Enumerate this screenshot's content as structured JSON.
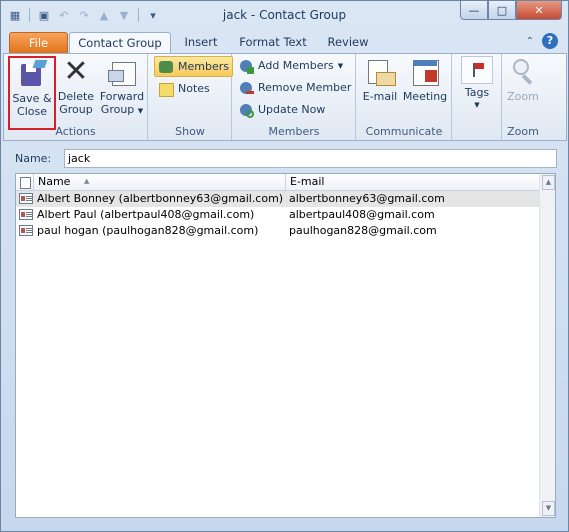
{
  "title": {
    "text": "jack  -  Contact Group"
  },
  "quick_access": [
    "outlook-icon",
    "save-icon",
    "undo-icon",
    "redo-icon",
    "up-icon",
    "down-icon",
    "customize-icon"
  ],
  "tabs": {
    "file": "File",
    "contact_group": "Contact Group",
    "insert": "Insert",
    "format_text": "Format Text",
    "review": "Review"
  },
  "ribbon": {
    "actions": {
      "save_close_1": "Save &",
      "save_close_2": "Close",
      "delete_1": "Delete",
      "delete_2": "Group",
      "forward_1": "Forward",
      "forward_2": "Group",
      "label": "Actions"
    },
    "show": {
      "members": "Members",
      "notes": "Notes",
      "label": "Show"
    },
    "members": {
      "add": "Add Members",
      "remove": "Remove Member",
      "update": "Update Now",
      "label": "Members"
    },
    "communicate": {
      "email": "E-mail",
      "meeting": "Meeting",
      "label": "Communicate"
    },
    "tags": {
      "tags": "Tags",
      "zoom_btn": "Zoom"
    },
    "zoom": {
      "zoom": "Zoom",
      "label": "Zoom"
    }
  },
  "name_field": {
    "label": "Name:",
    "value": "jack"
  },
  "list": {
    "headers": {
      "name": "Name",
      "email": "E-mail"
    },
    "rows": [
      {
        "name": "Albert Bonney (albertbonney63@gmail.com)",
        "email": "albertbonney63@gmail.com"
      },
      {
        "name": "Albert Paul (albertpaul408@gmail.com)",
        "email": "albertpaul408@gmail.com"
      },
      {
        "name": "paul hogan (paulhogan828@gmail.com)",
        "email": "paulhogan828@gmail.com"
      }
    ]
  },
  "colors": {
    "file_tab": "#e3731a",
    "highlight": "#d5202a",
    "selected_row": "#e5e5e5"
  }
}
